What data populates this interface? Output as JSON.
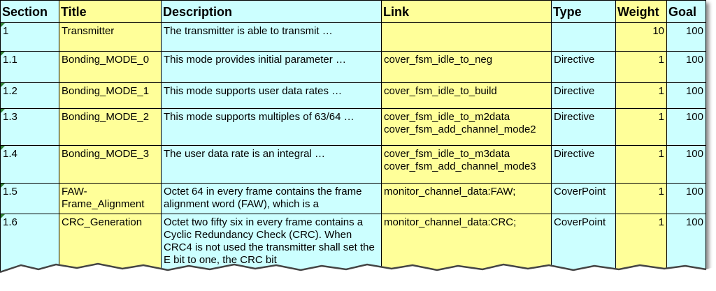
{
  "colors": {
    "cyan": "#ccffff",
    "yellow": "#ffff99",
    "comment_marker": "#2e7d32"
  },
  "headers": {
    "section": "Section",
    "title": "Title",
    "description": "Description",
    "link": "Link",
    "type": "Type",
    "weight": "Weight",
    "goal": "Goal"
  },
  "rows": [
    {
      "section": "1",
      "title": "Transmitter",
      "description": "The transmitter is able to transmit …",
      "link": "",
      "link2": "",
      "type": "",
      "weight": "10",
      "goal": "100"
    },
    {
      "section": "1.1",
      "title": "Bonding_MODE_0",
      "description": "This mode provides initial parameter …",
      "link": "cover_fsm_idle_to_neg",
      "link2": "",
      "type": "Directive",
      "weight": "1",
      "goal": "100"
    },
    {
      "section": "1.2",
      "title": "Bonding_MODE_1",
      "description": "This mode supports user data rates …",
      "link": "cover_fsm_idle_to_build",
      "link2": "",
      "type": "Directive",
      "weight": "1",
      "goal": "100"
    },
    {
      "section": "1.3",
      "title": "Bonding_MODE_2",
      "description": "This mode supports multiples of 63/64 …",
      "link": "cover_fsm_idle_to_m2data",
      "link2": "cover_fsm_add_channel_mode2",
      "type": "Directive",
      "weight": "1",
      "goal": "100"
    },
    {
      "section": "1.4",
      "title": "Bonding_MODE_3",
      "description": "The user data rate is an integral …",
      "link": "cover_fsm_idle_to_m3data",
      "link2": "cover_fsm_add_channel_mode3",
      "type": "Directive",
      "weight": "1",
      "goal": "100"
    },
    {
      "section": "1.5",
      "title": "FAW-Frame_Alignment",
      "description": "Octet 64 in every frame contains the frame alignment word (FAW), which is a",
      "link": "monitor_channel_data:FAW;",
      "link2": "",
      "type": "CoverPoint",
      "weight": "1",
      "goal": "100"
    },
    {
      "section": "1.6",
      "title": "CRC_Generation",
      "description": "Octet two fifty six in every frame contains a Cyclic Redundancy Check (CRC). When CRC4 is not used the transmitter shall set the E bit to one, the CRC bit",
      "link": "monitor_channel_data:CRC;",
      "link2": "",
      "type": "CoverPoint",
      "weight": "1",
      "goal": "100"
    }
  ]
}
